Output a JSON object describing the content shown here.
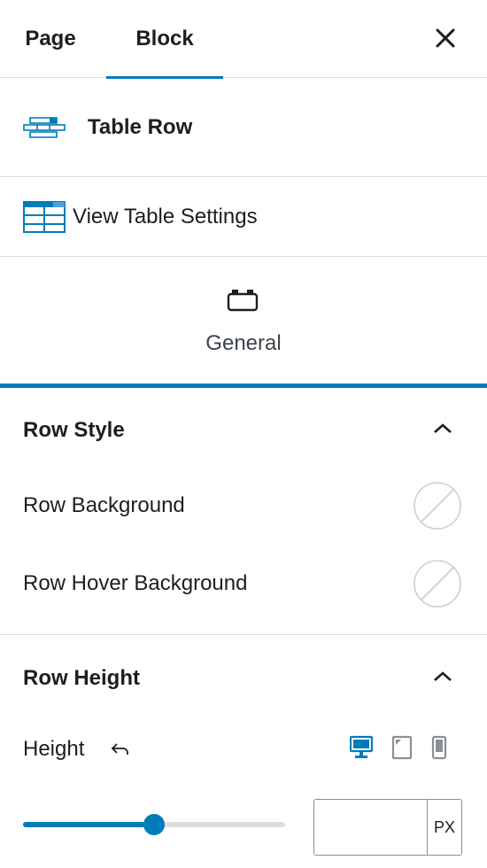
{
  "tabs": {
    "page": "Page",
    "block": "Block"
  },
  "block": {
    "title": "Table Row",
    "icon": "table-row-icon"
  },
  "table_settings": {
    "label": "View Table Settings",
    "icon": "table-icon"
  },
  "inspector_tab": {
    "label": "General",
    "icon": "briefcase-icon"
  },
  "row_style": {
    "title": "Row Style",
    "background_label": "Row Background",
    "hover_background_label": "Row Hover Background"
  },
  "row_height": {
    "title": "Row Height",
    "height_label": "Height",
    "unit": "PX",
    "slider_fraction": 0.5,
    "value": ""
  },
  "colors": {
    "accent": "#007cba",
    "border": "#dcdcde",
    "text": "#1e1e1e"
  }
}
